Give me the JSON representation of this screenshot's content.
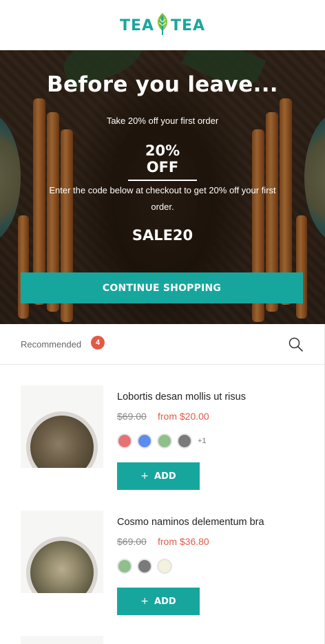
{
  "brand": {
    "logo_left": "TEA",
    "logo_right": "TEA",
    "accent": "#17a69e",
    "sale_color": "#e05a48"
  },
  "popup": {
    "title": "Before you leave...",
    "subtitle": "Take 20% off your first order",
    "offer": "20% OFF",
    "description": "Enter the code below at checkout to get 20% off your first order.",
    "code": "SALE20",
    "button_label": "CONTINUE SHOPPING"
  },
  "recommended": {
    "label": "Recommended",
    "count": "4",
    "search_icon": "search-icon"
  },
  "products": [
    {
      "name": "Lobortis desan mollis ut risus",
      "old_price": "$69.00",
      "new_price": "from $20.00",
      "swatches": [
        "#e57373",
        "#5b8def",
        "#8fbf8a",
        "#7a7a7a"
      ],
      "more_swatches": "+1",
      "add_label": "ADD"
    },
    {
      "name": "Cosmo naminos delementum bra",
      "old_price": "$69.00",
      "new_price": "from $36.80",
      "swatches": [
        "#8fbf8a",
        "#7a7a7a",
        "#f4f1dc"
      ],
      "more_swatches": "",
      "add_label": "ADD"
    }
  ]
}
